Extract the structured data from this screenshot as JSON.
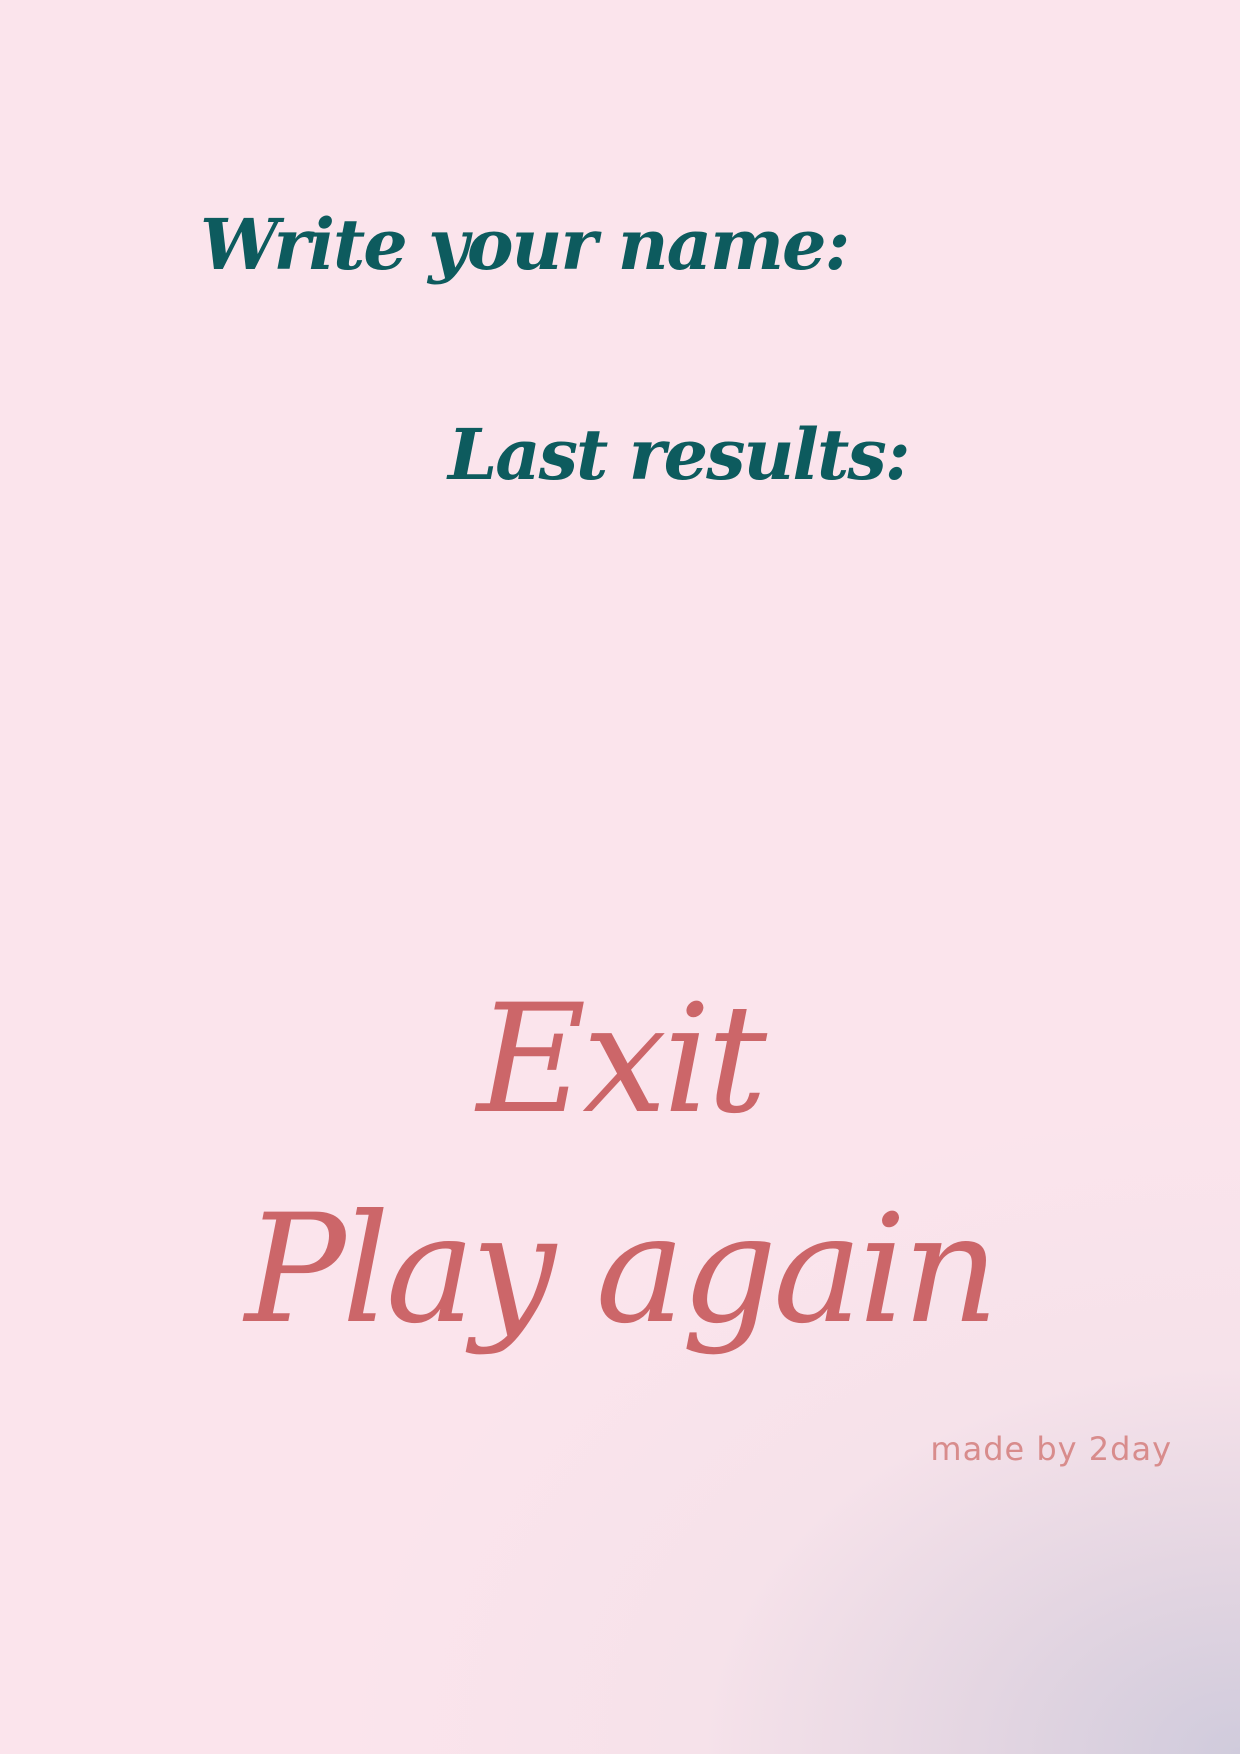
{
  "name_form": {
    "prompt": "Write your name:",
    "input_value": ""
  },
  "results": {
    "heading": "Last results:",
    "items": []
  },
  "menu": {
    "exit_label": "Exit",
    "play_again_label": "Play again"
  },
  "footer": {
    "credit": "made by 2day"
  },
  "colors": {
    "heading": "#0d5b5e",
    "button": "#cc6669",
    "credit": "#d88c8c",
    "background": "#fbe4ec"
  }
}
